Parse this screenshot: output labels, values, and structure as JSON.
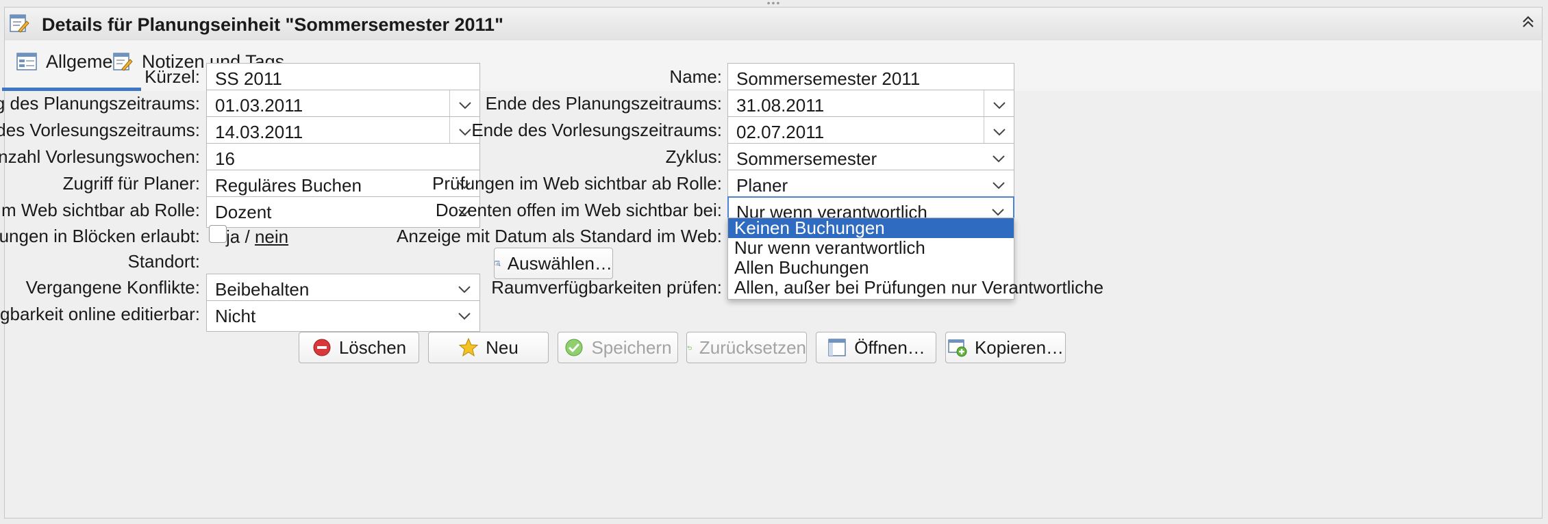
{
  "window": {
    "title": "Details für Planungseinheit \"Sommersemester 2011\""
  },
  "tabs": [
    {
      "label": "Allgemein",
      "active": true
    },
    {
      "label": "Notizen und Tags",
      "active": false
    }
  ],
  "left": {
    "kuerzel": {
      "label": "Kürzel:",
      "value": "SS 2011"
    },
    "anfang_planung": {
      "label": "Anfang des Planungszeitraums:",
      "value": "01.03.2011"
    },
    "anfang_vorlesung": {
      "label": "Anfang des Vorlesungszeitraums:",
      "value": "14.03.2011"
    },
    "anzahl_wochen": {
      "label": "Anzahl Vorlesungswochen:",
      "value": "16"
    },
    "zugriff": {
      "label": "Zugriff für Planer:",
      "value": "Reguläres Buchen"
    },
    "web_sichtbar": {
      "label": "Im Web sichtbar ab Rolle:",
      "value": "Dozent"
    },
    "bloecke": {
      "label": "Nur Buchungen in Blöcken erlaubt:",
      "yes": "ja",
      "sep": "/",
      "no": "nein"
    },
    "standort": {
      "label": "Standort:"
    },
    "konflikte": {
      "label": "Vergangene Konflikte:",
      "value": "Beibehalten"
    },
    "verfuegbarkeit": {
      "label": "Verfügbarkeit online editierbar:",
      "value": "Nicht"
    }
  },
  "right": {
    "name": {
      "label": "Name:",
      "value": "Sommersemester 2011"
    },
    "ende_planung": {
      "label": "Ende des Planungszeitraums:",
      "value": "31.08.2011"
    },
    "ende_vorlesung": {
      "label": "Ende des Vorlesungszeitraums:",
      "value": "02.07.2011"
    },
    "zyklus": {
      "label": "Zyklus:",
      "value": "Sommersemester"
    },
    "pruefungen": {
      "label": "Prüfungen im Web sichtbar ab Rolle:",
      "value": "Planer"
    },
    "dozenten": {
      "label": "Dozenten offen im Web sichtbar bei:",
      "value": "Nur wenn verantwortlich"
    },
    "anzeige_datum": {
      "label": "Anzeige mit Datum als Standard im Web:"
    },
    "auswaehlen_button": "Auswählen…",
    "raum": {
      "label": "Raumverfügbarkeiten prüfen:"
    }
  },
  "dropdown": {
    "options": [
      {
        "label": "Keinen Buchungen",
        "highlighted": true
      },
      {
        "label": "Nur wenn verantwortlich",
        "highlighted": false
      },
      {
        "label": "Allen Buchungen",
        "highlighted": false
      },
      {
        "label": "Allen, außer bei Prüfungen nur Verantwortliche",
        "highlighted": false
      }
    ]
  },
  "buttons": {
    "loeschen": "Löschen",
    "neu": "Neu",
    "speichern": "Speichern",
    "zuruecksetzen": "Zurücksetzen",
    "oeffnen": "Öffnen…",
    "kopieren": "Kopieren…"
  },
  "colors": {
    "accent": "#3d77c4",
    "selection": "#2f6bc1",
    "delete": "#d9383a",
    "star": "#f3c323",
    "save": "#62b33a"
  },
  "icons": {
    "title": "edit-form-icon",
    "collapse": "double-chevron-up-icon"
  }
}
